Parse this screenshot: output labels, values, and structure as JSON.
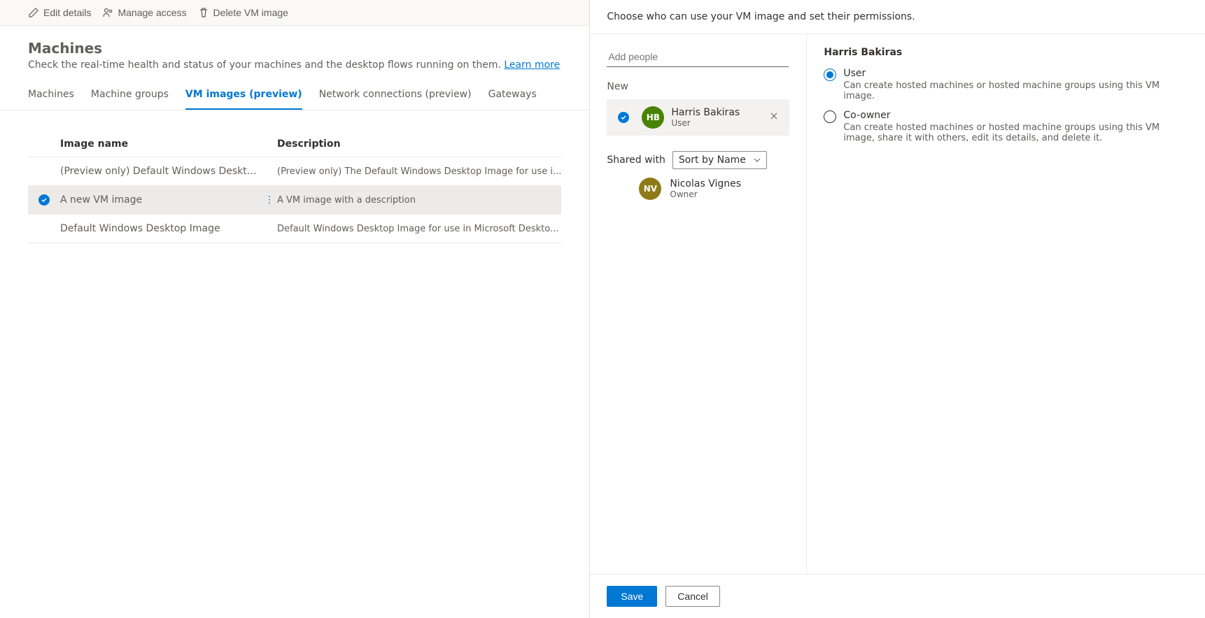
{
  "commandBar": {
    "edit": "Edit details",
    "manage": "Manage access",
    "delete": "Delete VM image"
  },
  "page": {
    "title": "Machines",
    "desc_prefix": "Check the real-time health and status of your machines and the desktop flows running on them. ",
    "learn_more": "Learn more"
  },
  "tabs": [
    {
      "label": "Machines"
    },
    {
      "label": "Machine groups"
    },
    {
      "label": "VM images (preview)"
    },
    {
      "label": "Network connections (preview)"
    },
    {
      "label": "Gateways"
    }
  ],
  "active_tab": 2,
  "table": {
    "col_name": "Image name",
    "col_desc": "Description",
    "rows": [
      {
        "name": "(Preview only) Default Windows Desktop Ima...",
        "desc": "(Preview only) The Default Windows Desktop Image for use i...",
        "selected": false
      },
      {
        "name": "A new VM image",
        "desc": "A VM image with a description",
        "selected": true
      },
      {
        "name": "Default Windows Desktop Image",
        "desc": "Default Windows Desktop Image for use in Microsoft Deskto...",
        "selected": false
      }
    ]
  },
  "panel": {
    "header": "Choose who can use your VM image and set their permissions.",
    "add_placeholder": "Add people",
    "new_label": "New",
    "new_person": {
      "name": "Harris Bakiras",
      "role": "User",
      "initials": "HB"
    },
    "shared_with": "Shared with",
    "sort_by": "Sort by Name",
    "shared_person": {
      "name": "Nicolas Vignes",
      "role": "Owner",
      "initials": "NV"
    },
    "right_title": "Harris Bakiras",
    "permissions": [
      {
        "label": "User",
        "desc": "Can create hosted machines or hosted machine groups using this VM image.",
        "selected": true
      },
      {
        "label": "Co-owner",
        "desc": "Can create hosted machines or hosted machine groups using this VM image, share it with others, edit its details, and delete it.",
        "selected": false
      }
    ],
    "save": "Save",
    "cancel": "Cancel"
  }
}
